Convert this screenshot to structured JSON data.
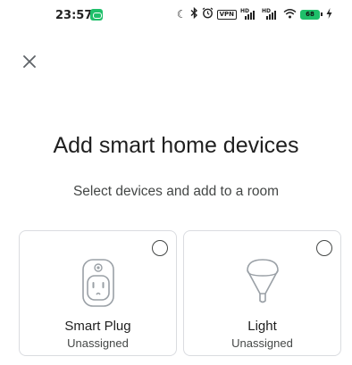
{
  "status_bar": {
    "time": "23:57",
    "vpn_label": "VPN",
    "signal_hd_1": "HD",
    "signal_hd_2": "HD",
    "battery_level": "68",
    "icons": [
      "moon-icon",
      "bluetooth-icon",
      "alarm-icon",
      "vpn-icon",
      "signal-icon",
      "signal-icon",
      "wifi-icon",
      "battery-icon",
      "charging-icon"
    ]
  },
  "header": {
    "close_icon": "close-icon"
  },
  "main": {
    "title": "Add smart home devices",
    "subtitle": "Select devices and add to a room"
  },
  "devices": [
    {
      "name": "Smart Plug",
      "status": "Unassigned",
      "icon": "smart-plug-icon",
      "selected": false
    },
    {
      "name": "Light",
      "status": "Unassigned",
      "icon": "light-bulb-icon",
      "selected": false
    }
  ],
  "colors": {
    "accent_green": "#1fbf6a",
    "card_border": "#dadce0",
    "text_primary": "#1f1f1f",
    "text_secondary": "#444746"
  }
}
